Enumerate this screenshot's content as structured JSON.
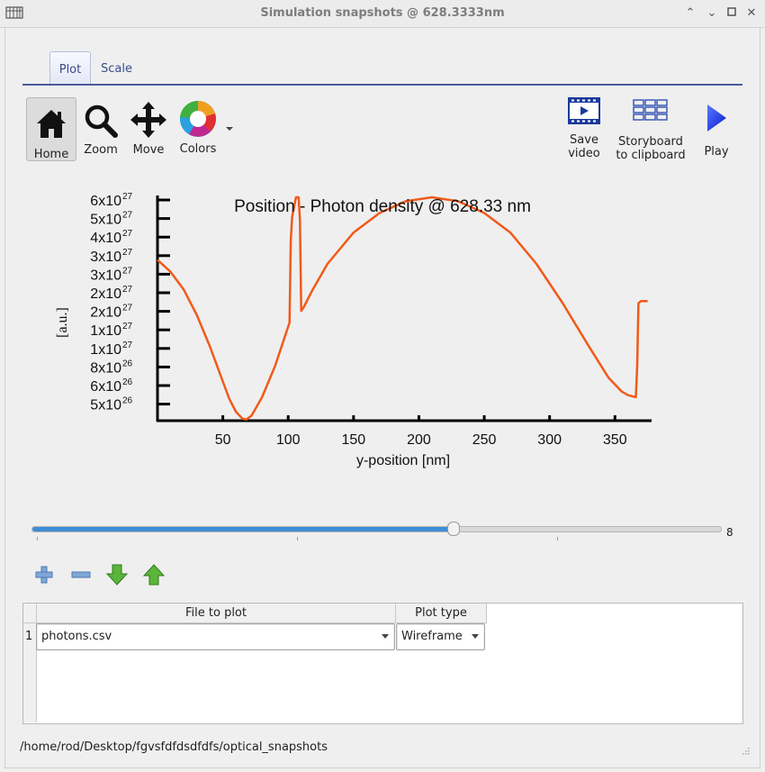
{
  "window": {
    "title": "Simulation snapshots @ 628.3333nm"
  },
  "tabs": [
    {
      "label": "Plot"
    },
    {
      "label": "Scale"
    }
  ],
  "toolbar": {
    "home": "Home",
    "zoom": "Zoom",
    "move": "Move",
    "colors": "Colors",
    "save_video_1": "Save",
    "save_video_2": "video",
    "storyboard_1": "Storyboard",
    "storyboard_2": "to clipboard",
    "play": "Play"
  },
  "chart_data": {
    "type": "line",
    "title": "Position - Photon density @ 628.33 nm",
    "xlabel": "y-position [nm]",
    "ylabel": "[a.u.]",
    "x_ticks": [
      "50",
      "100",
      "150",
      "200",
      "250",
      "300",
      "350"
    ],
    "y_ticks": [
      "6x10",
      "5x10",
      "4x10",
      "3x10",
      "3x10",
      "2x10",
      "2x10",
      "1x10",
      "1x10",
      "8x10",
      "6x10",
      "5x10"
    ],
    "y_tick_exponents": [
      "27",
      "27",
      "27",
      "27",
      "27",
      "27",
      "27",
      "27",
      "27",
      "26",
      "26",
      "26"
    ],
    "xlim": [
      0,
      378
    ],
    "ylim": [
      4e+26,
      6.1e+27
    ],
    "series": [
      {
        "color": "#f05a1a",
        "x": [
          0,
          10,
          20,
          30,
          40,
          50,
          55,
          60,
          65,
          68,
          72,
          80,
          90,
          98,
          100,
          101,
          102,
          103,
          106,
          108,
          109,
          110,
          112,
          118,
          130,
          150,
          170,
          190,
          210,
          230,
          250,
          270,
          290,
          310,
          330,
          345,
          355,
          360,
          366,
          367,
          368,
          370,
          375
        ],
        "y": [
          4.5e+27,
          4.2e+27,
          3.75e+27,
          3.1e+27,
          2.3e+27,
          1.4e+27,
          9.5e+26,
          6.3e+26,
          4.5e+26,
          4.3e+26,
          5.3e+26,
          1e+27,
          1.8e+27,
          2.6e+27,
          2.8e+27,
          2.9e+27,
          5e+27,
          5.6e+27,
          6.1e+27,
          6.1e+27,
          5.5e+27,
          3.2e+27,
          3.3e+27,
          3.7e+27,
          4.4e+27,
          5.2e+27,
          5.7e+27,
          6e+27,
          6.1e+27,
          6e+27,
          5.7e+27,
          5.2e+27,
          4.4e+27,
          3.4e+27,
          2.3e+27,
          1.5e+27,
          1.15e+27,
          1.05e+27,
          1e+27,
          1.8e+27,
          3.4e+27,
          3.45e+27,
          3.45e+27
        ]
      }
    ]
  },
  "slider": {
    "value": "8",
    "fraction": 0.61
  },
  "table": {
    "headers": [
      "File to plot",
      "Plot type"
    ],
    "rows": [
      {
        "num": "1",
        "file": "photons.csv",
        "type": "Wireframe"
      }
    ]
  },
  "status": {
    "path": "/home/rod/Desktop/fgvsfdfdsdfdfs/optical_snapshots"
  }
}
